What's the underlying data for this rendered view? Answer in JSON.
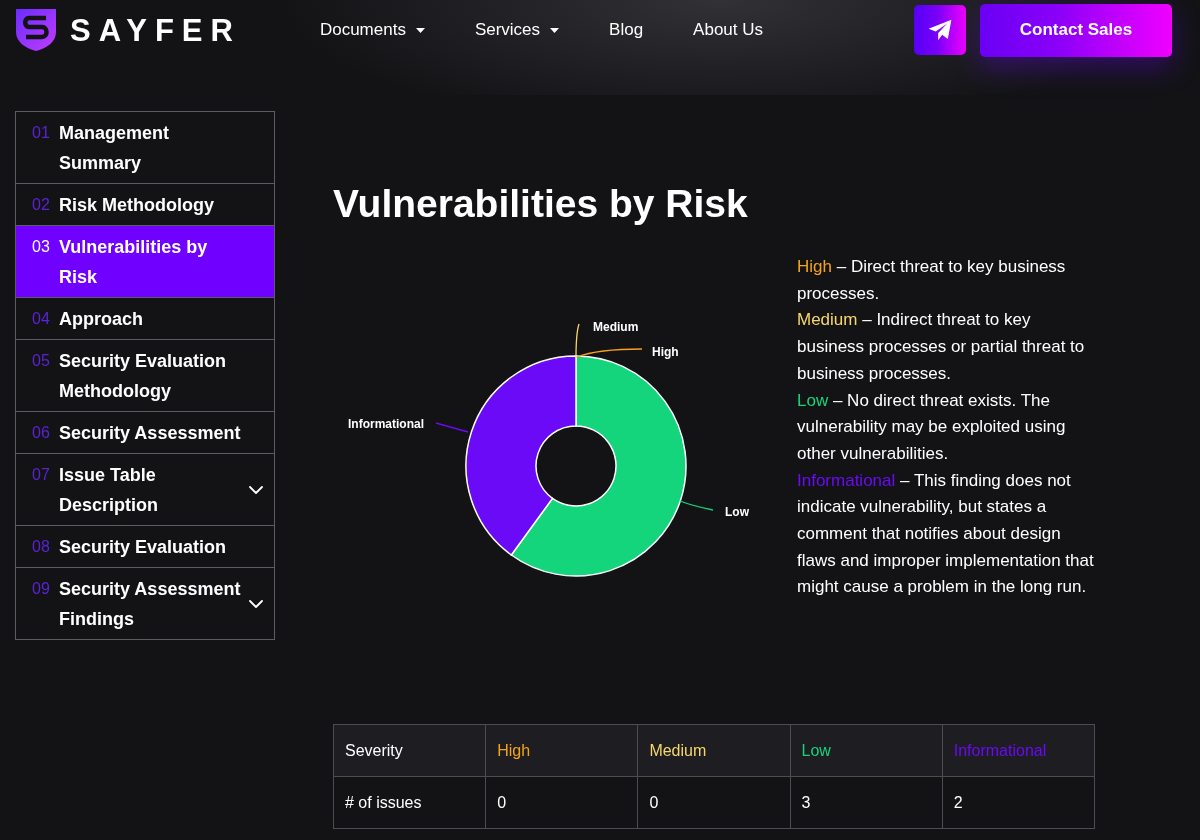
{
  "header": {
    "logo": {
      "text": "SAYFER"
    },
    "nav": [
      {
        "label": "Documents",
        "kind": "dropdown"
      },
      {
        "label": "Services",
        "kind": "dropdown"
      },
      {
        "label": "Blog",
        "kind": "link"
      },
      {
        "label": "About Us",
        "kind": "link"
      }
    ],
    "cta": {
      "label": "Contact Sales"
    }
  },
  "sidebar": {
    "items": [
      {
        "number": "01",
        "title": "Management Summary",
        "kind": "link",
        "selected": false
      },
      {
        "number": "02",
        "title": "Risk Methodology",
        "kind": "link",
        "selected": false
      },
      {
        "number": "03",
        "title": "Vulnerabilities by Risk",
        "kind": "link",
        "selected": true
      },
      {
        "number": "04",
        "title": "Approach",
        "kind": "link",
        "selected": false
      },
      {
        "number": "05",
        "title": "Security Evaluation Methodology",
        "kind": "link",
        "selected": false
      },
      {
        "number": "06",
        "title": "Security Assessment",
        "kind": "link",
        "selected": false
      },
      {
        "number": "07",
        "title": "Issue Table Description",
        "kind": "group",
        "expanded": false,
        "selected": false
      },
      {
        "number": "08",
        "title": "Security Evaluation",
        "kind": "link",
        "selected": false
      },
      {
        "number": "09",
        "title": "Security Assessment Findings",
        "kind": "group",
        "expanded": false,
        "selected": false
      }
    ]
  },
  "main": {
    "title": "Vulnerabilities by Risk",
    "chart": {
      "chart_data": {
        "type": "donut",
        "categories": [
          "High",
          "Medium",
          "Low",
          "Informational"
        ],
        "values": [
          0,
          0,
          60,
          40
        ]
      }
    },
    "legend": [
      {
        "label": "High",
        "color": "#f5a31a",
        "text": "– Direct threat to key business processes."
      },
      {
        "label": "Medium",
        "color": "#f7d66b",
        "text": "– Indirect threat to key business processes or partial threat to business processes."
      },
      {
        "label": "Low",
        "color": "#14d47c",
        "text": "– No direct threat exists. The vulnerability may be exploited using other vulnerabilities."
      },
      {
        "label": "Informational",
        "color": "#6a0af6",
        "text": "– This finding does not indicate vulnerability, but states a comment that notifies about design flaws and improper implementation that might cause a problem in the long run."
      }
    ],
    "table": {
      "columns": [
        {
          "label": "Severity"
        },
        {
          "label": "High",
          "color": "#f5a31a"
        },
        {
          "label": "Medium",
          "color": "#f7d66b"
        },
        {
          "label": "Low",
          "color": "#14d47c"
        },
        {
          "label": "Informational",
          "color": "#6a0af6"
        }
      ],
      "rows": [
        {
          "cells": [
            "# of issues",
            "0",
            "0",
            "3",
            "2"
          ]
        }
      ]
    }
  }
}
